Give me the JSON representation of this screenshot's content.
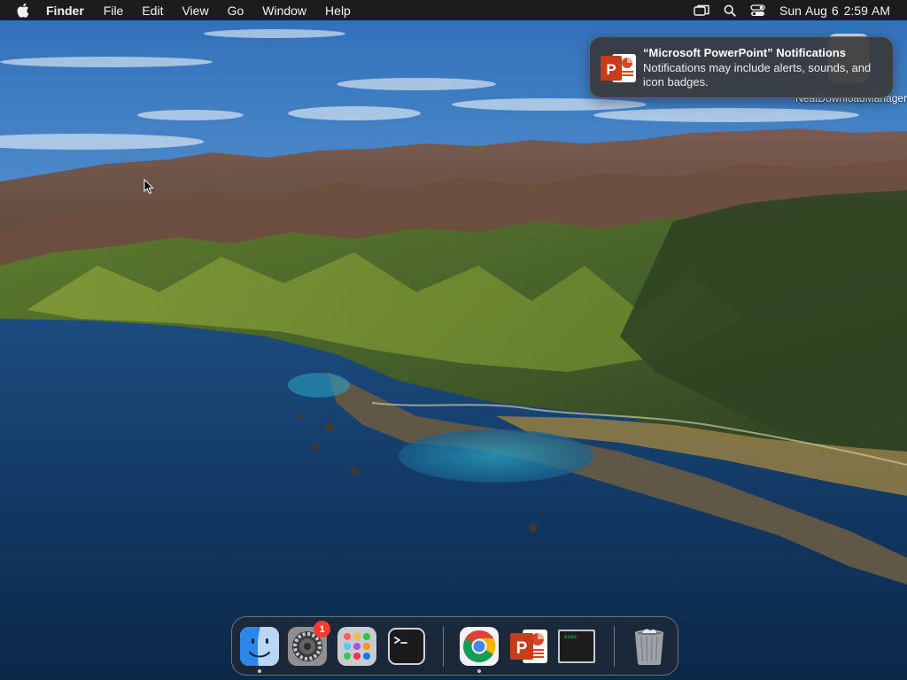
{
  "menubar": {
    "app_name": "Finder",
    "items": [
      "File",
      "Edit",
      "View",
      "Go",
      "Window",
      "Help"
    ],
    "clock": {
      "date": "Sun Aug 6",
      "time": "2:59 AM"
    },
    "status_icons": [
      "screen-mirroring-icon",
      "spotlight-search-icon",
      "control-center-icon"
    ]
  },
  "desktop_icon": {
    "label": "NeatDownloadManager"
  },
  "notification": {
    "title": "“Microsoft PowerPoint” Notifications",
    "body": "Notifications may include alerts, sounds, and icon badges.",
    "app_icon": "powerpoint-icon"
  },
  "dock": {
    "items": [
      {
        "name": "Finder",
        "icon": "finder-icon",
        "running": true
      },
      {
        "name": "System Preferences",
        "icon": "system-preferences-icon",
        "badge": "1",
        "running": false
      },
      {
        "name": "Launchpad",
        "icon": "launchpad-icon",
        "running": false
      },
      {
        "name": "Terminal",
        "icon": "terminal-icon",
        "running": false
      },
      {
        "name": "Google Chrome",
        "icon": "chrome-icon",
        "running": true
      },
      {
        "name": "Microsoft PowerPoint",
        "icon": "powerpoint-icon",
        "running": false
      },
      {
        "name": "exec",
        "icon": "exec-terminal-icon",
        "running": false
      },
      {
        "name": "Trash",
        "icon": "trash-icon",
        "running": false
      }
    ],
    "exec_label": "exec"
  },
  "colors": {
    "menubar_bg": "#1c1c1e",
    "powerpoint_orange": "#d24726",
    "badge_red": "#ff3b30",
    "sky": "#3a7fc4",
    "ocean": "#123a63"
  }
}
